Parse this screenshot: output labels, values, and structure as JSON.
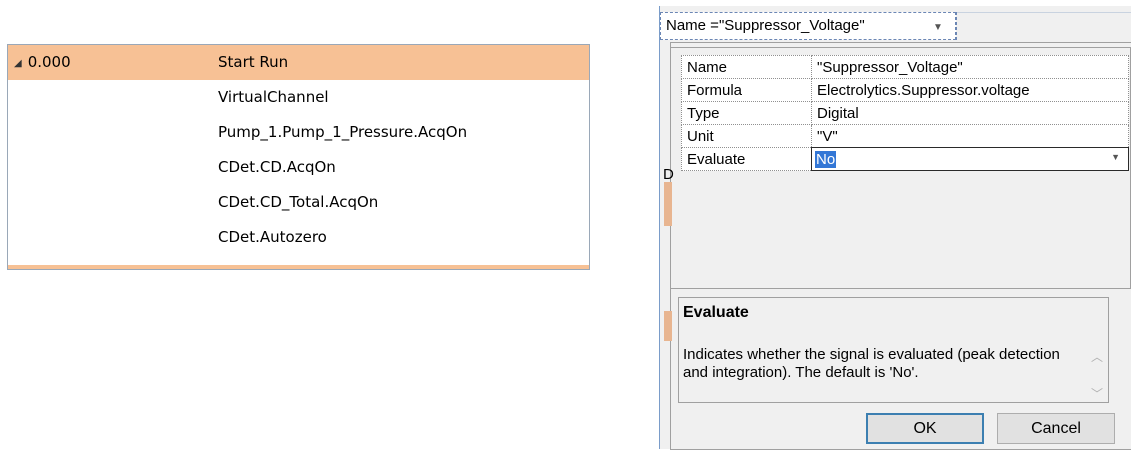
{
  "method_table": {
    "rows": [
      {
        "time": "0.000",
        "command": "Start Run",
        "selected": true,
        "expanded": true
      },
      {
        "time": "",
        "command": "VirtualChannel"
      },
      {
        "time": "",
        "command": "Pump_1.Pump_1_Pressure.AcqOn"
      },
      {
        "time": "",
        "command": "CDet.CD.AcqOn"
      },
      {
        "time": "",
        "command": "CDet.CD_Total.AcqOn"
      },
      {
        "time": "",
        "command": "CDet.Autozero"
      }
    ],
    "expand_icon": "collapse-triangle-icon"
  },
  "dialog": {
    "name_combo": "Name =\"Suppressor_Voltage\"",
    "properties": [
      {
        "name": "Name",
        "value": "\"Suppressor_Voltage\""
      },
      {
        "name": "Formula",
        "value": "Electrolytics.Suppressor.voltage"
      },
      {
        "name": "Type",
        "value": "Digital"
      },
      {
        "name": "Unit",
        "value": "\"V\""
      },
      {
        "name": "Evaluate",
        "value": "No"
      }
    ],
    "background_letter": "D",
    "help": {
      "title": "Evaluate",
      "text": "Indicates whether the signal is evaluated (peak detection and integration). The default is 'No'."
    },
    "ok_label": "OK",
    "cancel_label": "Cancel"
  },
  "colors": {
    "selection_row": "#f7c195",
    "selected_value_highlight": "#3377d6",
    "default_button_border": "#3c7fb1"
  }
}
